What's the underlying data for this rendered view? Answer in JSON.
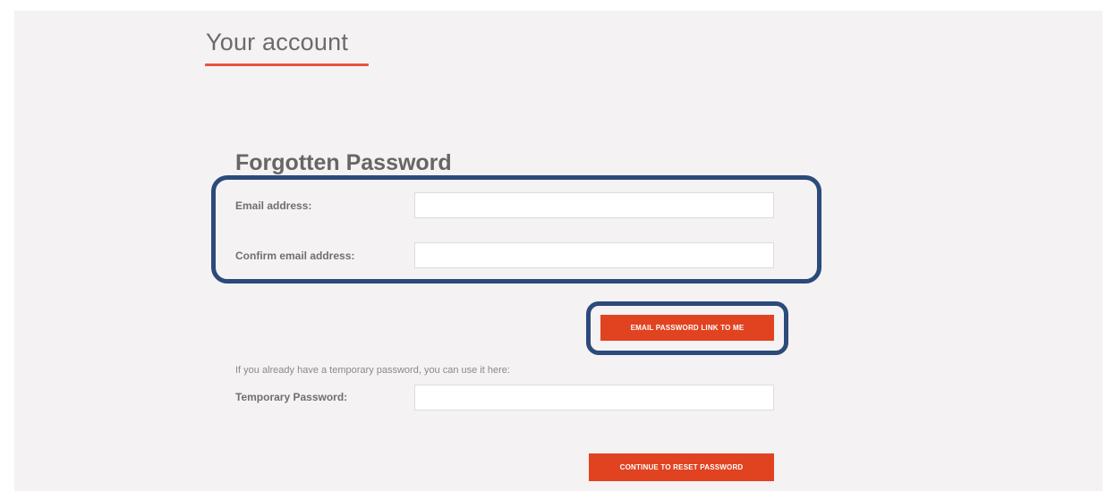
{
  "header": {
    "title": "Your account"
  },
  "form": {
    "title": "Forgotten Password",
    "email_label": "Email address:",
    "email_value": "",
    "confirm_email_label": "Confirm email address:",
    "confirm_email_value": "",
    "email_button_label": "EMAIL PASSWORD LINK TO ME",
    "temp_hint": "If you already have a temporary password, you can use it here:",
    "temp_password_label": "Temporary Password:",
    "temp_password_value": "",
    "continue_button_label": "CONTINUE TO RESET PASSWORD"
  },
  "colors": {
    "accent": "#e14321",
    "underline": "#e8553b",
    "highlight": "#2c4a7a",
    "panel_background": "#f4f2f3"
  }
}
